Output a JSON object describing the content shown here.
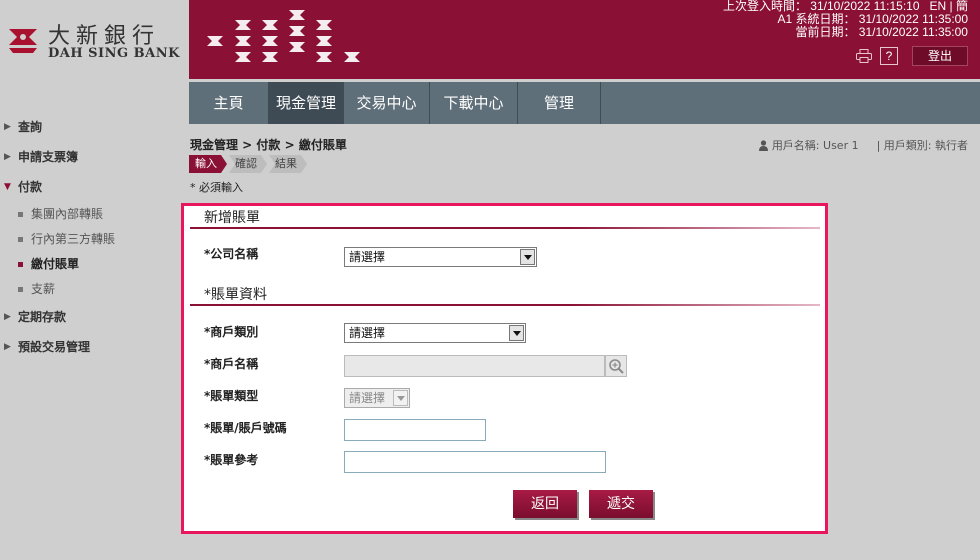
{
  "logo": {
    "cn": "大新銀行",
    "en": "DAH SING BANK"
  },
  "header": {
    "last_login": "上次登入時間： 31/10/2022 11:15:10",
    "lang_en": "EN",
    "lang_sep": " | ",
    "lang_tc": "簡",
    "system_date": "A1 系統日期： 31/10/2022 11:35:00",
    "current_date": "當前日期： 31/10/2022 11:35:00",
    "help_label": "?",
    "logout_label": "登出"
  },
  "nav": [
    {
      "label": "主頁",
      "w": 80
    },
    {
      "label": "現金管理",
      "w": 75
    },
    {
      "label": "交易中心",
      "w": 86
    },
    {
      "label": "下載中心",
      "w": 88
    },
    {
      "label": "管理",
      "w": 83
    }
  ],
  "sidebar": {
    "query": "查詢",
    "cheque": "申請支票簿",
    "payment": "付款",
    "sub": [
      "集團內部轉賬",
      "行內第三方轉賬",
      "繳付賬單",
      "支薪"
    ],
    "deposit": "定期存款",
    "preset": "預設交易管理"
  },
  "breadcrumb": "現金管理 > 付款 > 繳付賬單",
  "userinfo": {
    "user": "用戶名稱: User 1",
    "role": "| 用戶類別: 執行者"
  },
  "steps": [
    "輸入",
    "確認",
    "結果"
  ],
  "required_note": "* 必須輸入",
  "form": {
    "section1_title": "新增賬單",
    "company_label": "*公司名稱",
    "company_value": "請選擇",
    "section2_title": "*賬單資料",
    "merchant_type_label": "*商戶類別",
    "merchant_type_value": "請選擇",
    "merchant_name_label": "*商戶名稱",
    "bill_type_label": "*賬單類型",
    "bill_type_value": "請選擇",
    "account_no_label": "*賬單/賬戶號碼",
    "reference_label": "*賬單參考",
    "back_label": "返回",
    "submit_label": "遞交"
  }
}
